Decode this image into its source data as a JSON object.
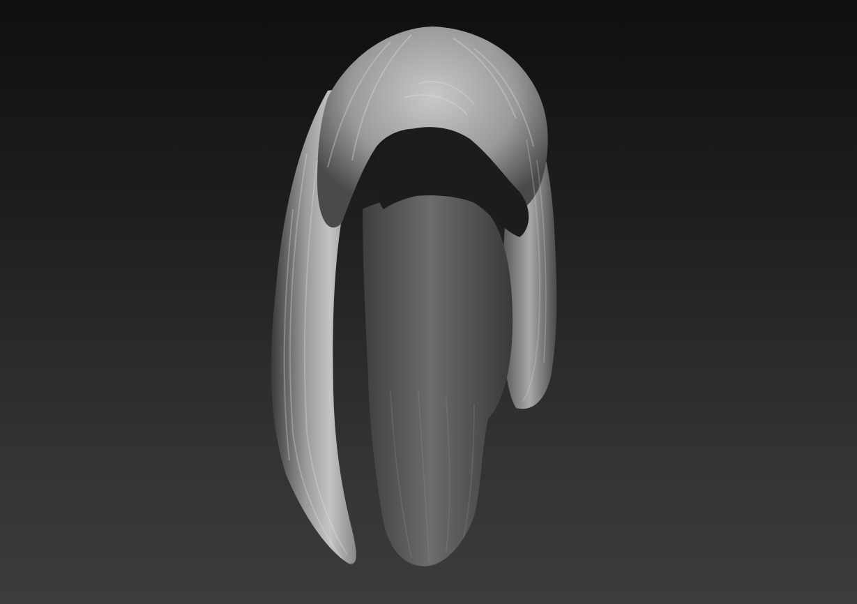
{
  "scene": {
    "subject_icon": "hair-sculpt-icon",
    "colors": {
      "background_top": "#0f0f0f",
      "background_bottom": "#3c3c3c",
      "material_highlight": "#c8c8c8",
      "material_mid": "#8a8a8a",
      "material_shadow": "#2a2a2a"
    }
  }
}
